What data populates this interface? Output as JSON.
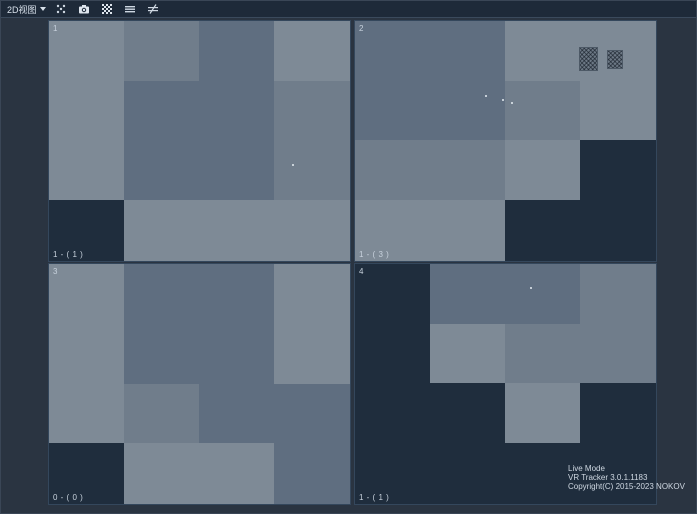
{
  "toolbar": {
    "view_label": "2D视图",
    "buttons": [
      {
        "icon": "markers-icon"
      },
      {
        "icon": "camera-icon"
      },
      {
        "icon": "checkerboard-icon"
      },
      {
        "icon": "menu-lines-icon"
      },
      {
        "icon": "strike-icon"
      }
    ]
  },
  "viewports": [
    {
      "index": "1",
      "status": "1 - ( 1 )"
    },
    {
      "index": "2",
      "status": "1 - ( 3 )"
    },
    {
      "index": "3",
      "status": "0 - ( 0 )"
    },
    {
      "index": "4",
      "status": "1 - ( 1 )"
    }
  ],
  "info": {
    "mode": "Live Mode",
    "version": "VR Tracker 3.0.1.1183",
    "copyright": "Copyright(C) 2015-2023 NOKOV"
  }
}
